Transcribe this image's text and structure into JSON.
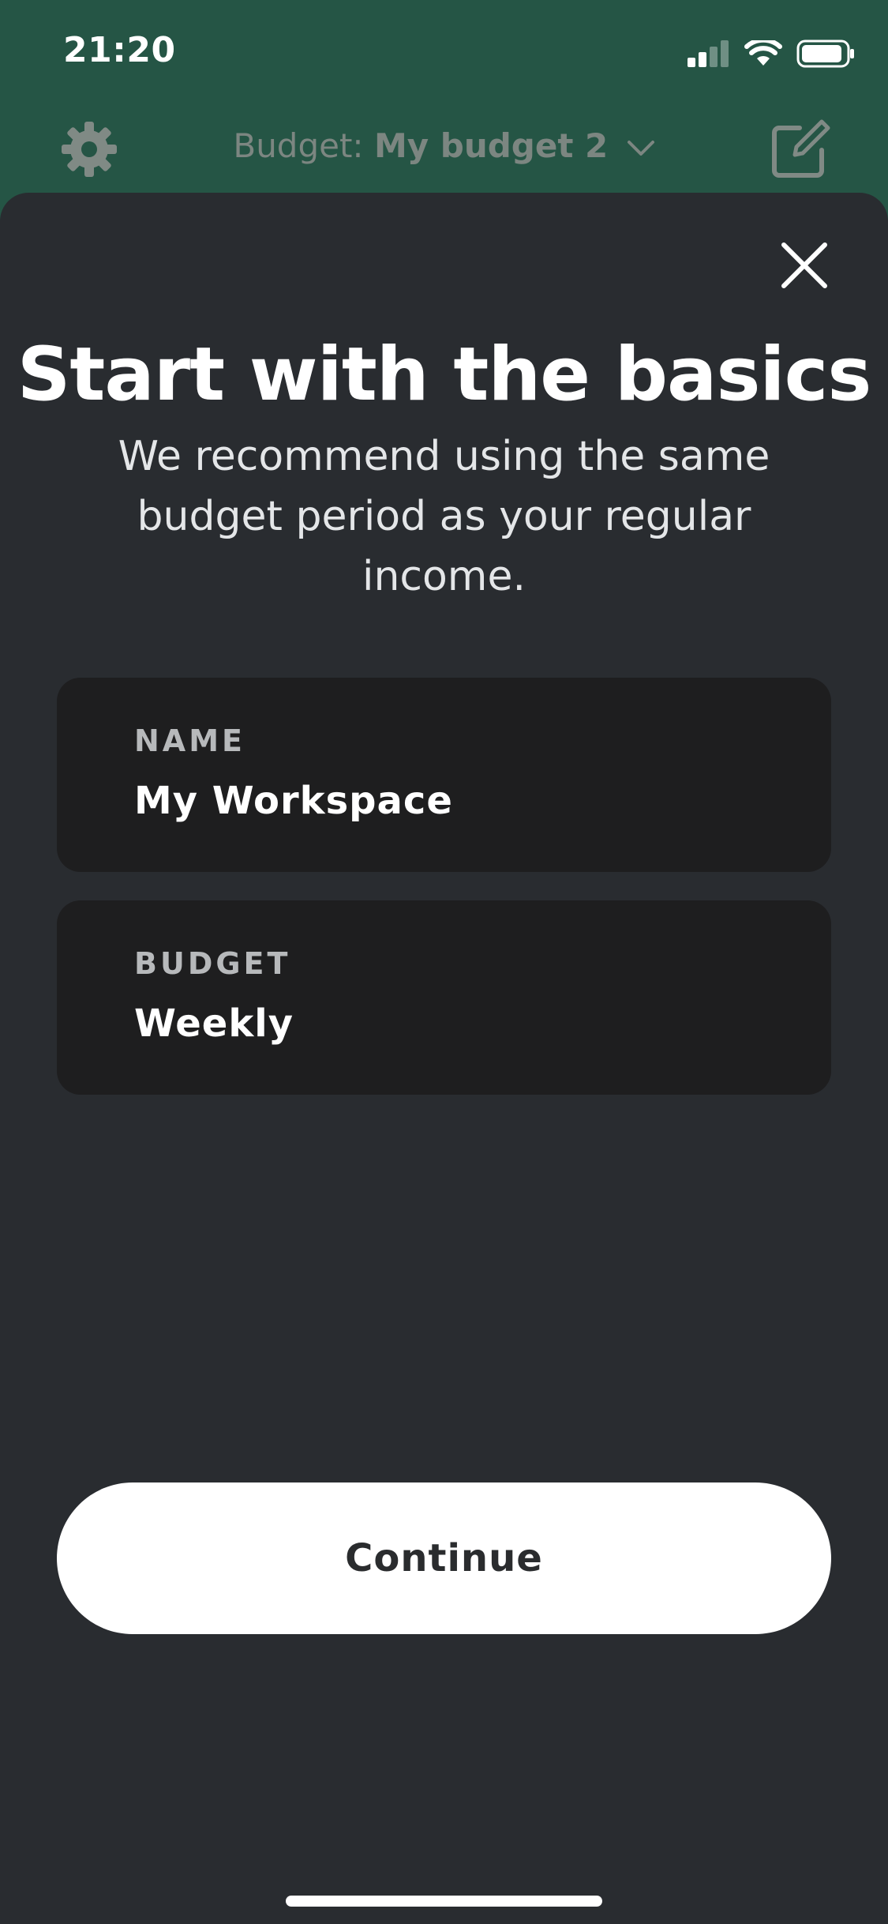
{
  "status_bar": {
    "time": "21:20",
    "icons": [
      "signal-icon",
      "wifi-icon",
      "battery-icon"
    ]
  },
  "nav": {
    "settings_icon": "gear-icon",
    "budget_label": "Budget:",
    "budget_name": "My budget 2",
    "dropdown_icon": "chevron-down-icon",
    "edit_icon": "edit-icon"
  },
  "sheet": {
    "close_icon": "close-icon",
    "title": "Start with the basics",
    "subtitle": "We recommend using the same budget period as your regular income.",
    "fields": [
      {
        "label": "NAME",
        "value": "My Workspace"
      },
      {
        "label": "BUDGET",
        "value": "Weekly"
      }
    ],
    "continue_label": "Continue"
  },
  "colors": {
    "header_green": "#255545",
    "sheet_bg": "#292c30",
    "card_bg": "#1e1e1f",
    "button_bg": "#ffffff",
    "button_text": "#2a2c2e"
  }
}
